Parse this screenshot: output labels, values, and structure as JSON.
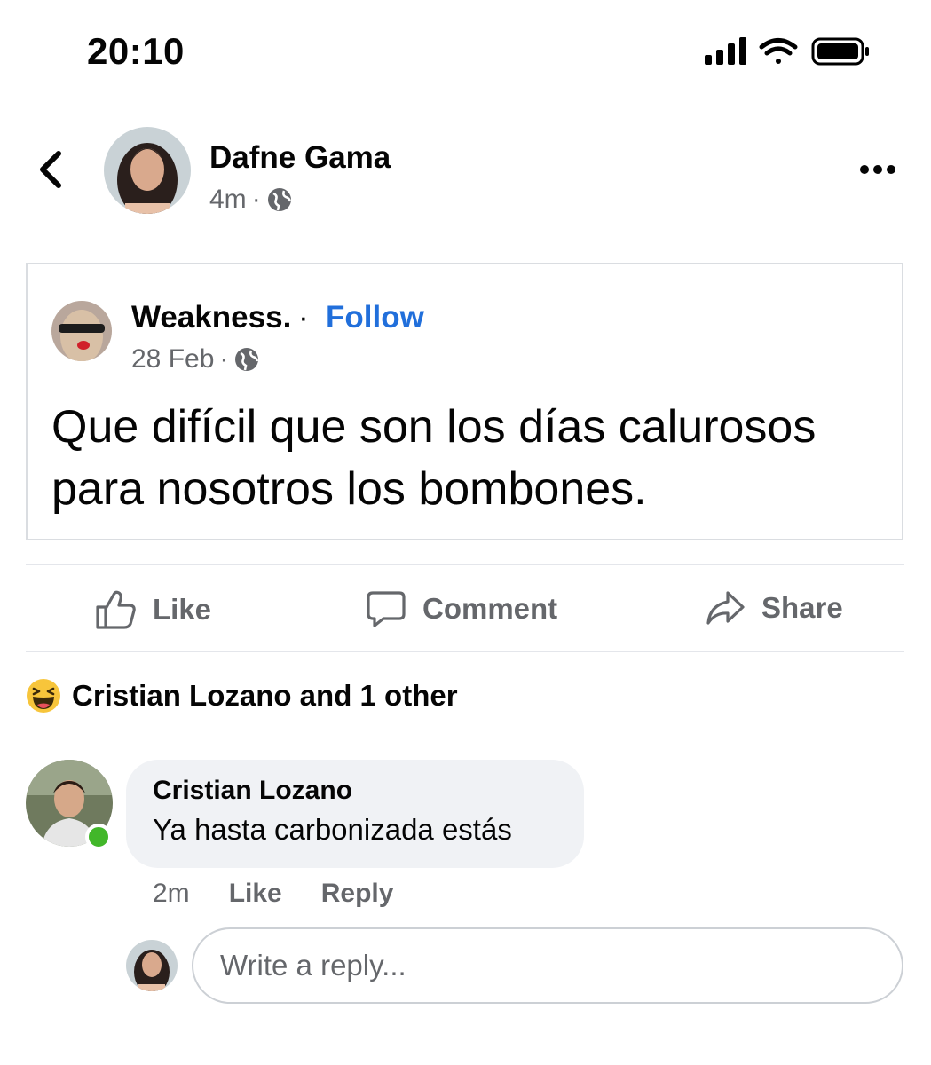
{
  "status_bar": {
    "time": "20:10"
  },
  "post": {
    "author": "Dafne Gama",
    "time": "4m",
    "shared": {
      "author": "Weakness.",
      "separator": "·",
      "follow_label": "Follow",
      "date": "28 Feb",
      "text": "Que difícil que son los días calurosos para nosotros los bombones."
    }
  },
  "actions": {
    "like": "Like",
    "comment": "Comment",
    "share": "Share"
  },
  "reactions": {
    "summary": "Cristian Lozano and 1 other",
    "emoji": "haha"
  },
  "comment": {
    "author": "Cristian Lozano",
    "text": "Ya hasta carbonizada estás",
    "time": "2m",
    "like": "Like",
    "reply": "Reply"
  },
  "reply_box": {
    "placeholder": "Write a reply..."
  },
  "colors": {
    "accent": "#216fdb",
    "muted": "#65676b",
    "online": "#42b72a",
    "bubble": "#f0f2f5"
  }
}
